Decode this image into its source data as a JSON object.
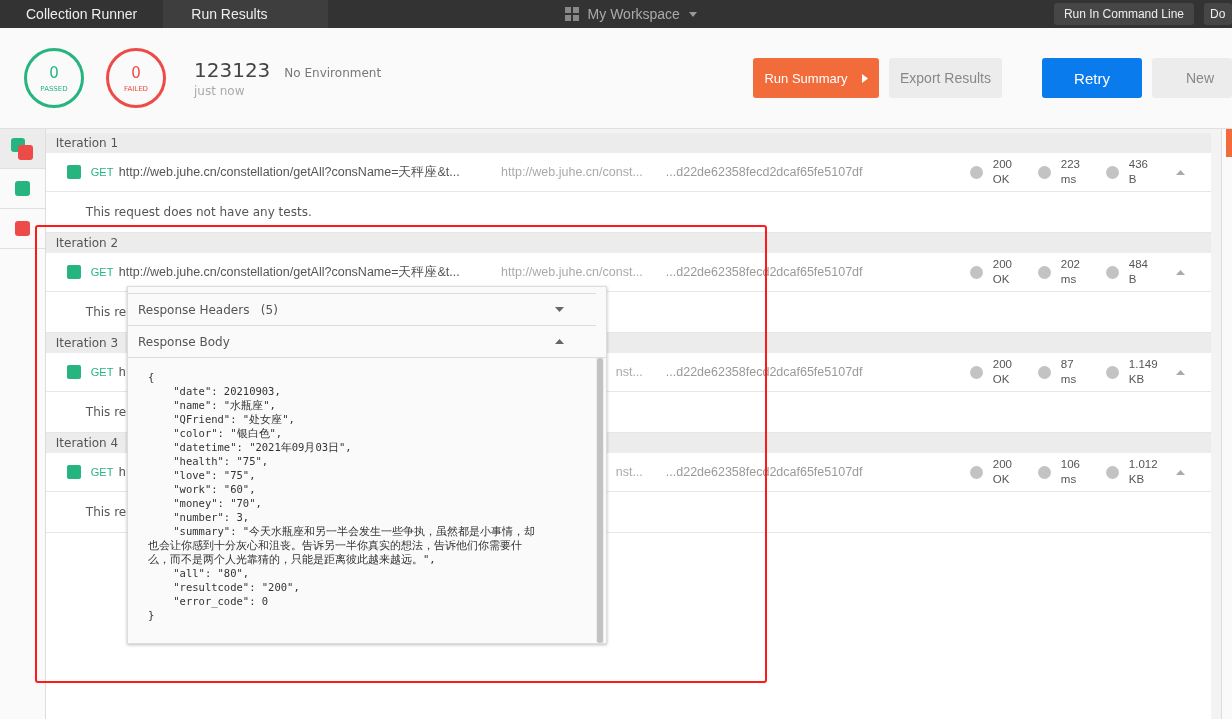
{
  "topbar": {
    "tabs": [
      {
        "label": "Collection Runner",
        "selected": false
      },
      {
        "label": "Run Results",
        "selected": true
      }
    ],
    "workspace": "My Workspace",
    "buttons": [
      "Run In Command Line",
      "Do"
    ]
  },
  "summary": {
    "passed": {
      "count": "0",
      "label": "PASSED"
    },
    "failed": {
      "count": "0",
      "label": "FAILED"
    },
    "name": "123123",
    "environment": "No Environment",
    "time": "just now"
  },
  "actions": [
    {
      "label": "Run Summary",
      "kind": "primary-orange"
    },
    {
      "label": "Export Results",
      "kind": "plain"
    },
    {
      "label": "Retry",
      "kind": "primary-blue"
    },
    {
      "label": "New",
      "kind": "plain"
    }
  ],
  "sidebar": {
    "items": [
      {
        "kind": "mixed",
        "selected": true
      },
      {
        "kind": "pass",
        "selected": false
      },
      {
        "kind": "fail",
        "selected": false
      }
    ]
  },
  "iterations": [
    {
      "title": "Iteration 1",
      "method": "GET",
      "url": "http://web.juhe.cn/constellation/getAll?consName=天秤座&t...",
      "url2": "http://web.juhe.cn/const...",
      "key": "...d22de62358fecd2dcaf65fe5107df",
      "status": [
        "200",
        "OK"
      ],
      "time": [
        "223",
        "ms"
      ],
      "size": [
        "436",
        "B"
      ],
      "message": "This request does not have any tests."
    },
    {
      "title": "Iteration 2",
      "method": "GET",
      "url": "http://web.juhe.cn/constellation/getAll?consName=天秤座&t...",
      "url2": "http://web.juhe.cn/const...",
      "key": "...d22de62358fecd2dcaf65fe5107df",
      "status": [
        "200",
        "OK"
      ],
      "time": [
        "202",
        "ms"
      ],
      "size": [
        "484",
        "B"
      ],
      "message": "This re"
    },
    {
      "title": "Iteration 3",
      "method": "GET",
      "url": "h",
      "url2": "nst...",
      "key": "...d22de62358fecd2dcaf65fe5107df",
      "status": [
        "200",
        "OK"
      ],
      "time": [
        "87",
        "ms"
      ],
      "size": [
        "1.149",
        "KB"
      ],
      "message": "This re"
    },
    {
      "title": "Iteration 4",
      "method": "GET",
      "url": "h",
      "url2": "nst...",
      "key": "...d22de62358fecd2dcaf65fe5107df",
      "status": [
        "200",
        "OK"
      ],
      "time": [
        "106",
        "ms"
      ],
      "size": [
        "1.012",
        "KB"
      ],
      "message": "This re"
    }
  ],
  "popup": {
    "sections": [
      {
        "title": "Response Headers",
        "count": "(5)",
        "expanded": false
      },
      {
        "title": "Response Body",
        "expanded": true
      }
    ],
    "body": "{\n    \"date\": 20210903,\n    \"name\": \"水瓶座\",\n    \"QFriend\": \"处女座\",\n    \"color\": \"银白色\",\n    \"datetime\": \"2021年09月03日\",\n    \"health\": \"75\",\n    \"love\": \"75\",\n    \"work\": \"60\",\n    \"money\": \"70\",\n    \"number\": 3,\n    \"summary\": \"今天水瓶座和另一半会发生一些争执，虽然都是小事情，却也会让你感到十分灰心和沮丧。告诉另一半你真实的想法，告诉他们你需要什么，而不是两个人光靠猜的，只能是距离彼此越来越远。\",\n    \"all\": \"80\",\n    \"resultcode\": \"200\",\n    \"error_code\": 0\n}"
  },
  "highlight": {
    "color": "#ff1a1a"
  }
}
